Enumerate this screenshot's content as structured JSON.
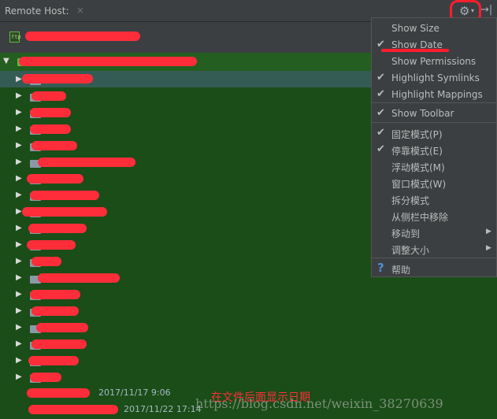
{
  "titlebar": {
    "title": "Remote Host:",
    "close": "×",
    "gear": "⚙",
    "gear_caret": "▾",
    "pin": "→|"
  },
  "tree": {
    "dates": [
      "2017/11/17 9:06",
      "2017/11/22 17:14"
    ]
  },
  "menu": {
    "show_size": "Show Size",
    "show_date": "Show Date",
    "show_permissions": "Show Permissions",
    "highlight_symlinks": "Highlight Symlinks",
    "highlight_mappings": "Highlight Mappings",
    "show_toolbar": "Show Toolbar",
    "pinned_mode": "固定模式(P)",
    "docked_mode": "停靠模式(E)",
    "float_mode": "浮动模式(M)",
    "windowed_mode": "窗口模式(W)",
    "split_mode": "拆分模式",
    "remove_from_sidebar": "从侧栏中移除",
    "move_to": "移动到",
    "resize": "调整大小",
    "help": "帮助",
    "check": "✔",
    "submenu_arrow": "▶",
    "help_icon": "?"
  },
  "annotation": "在文件后面显示日期",
  "watermark": "https://blog.csdn.net/weixin_38270639",
  "colors": {
    "tree_bg": "#1b4d18",
    "menu_bg": "#3c3f41",
    "scribble": "#ff2d3a",
    "help_icon": "#4a8fd1"
  }
}
